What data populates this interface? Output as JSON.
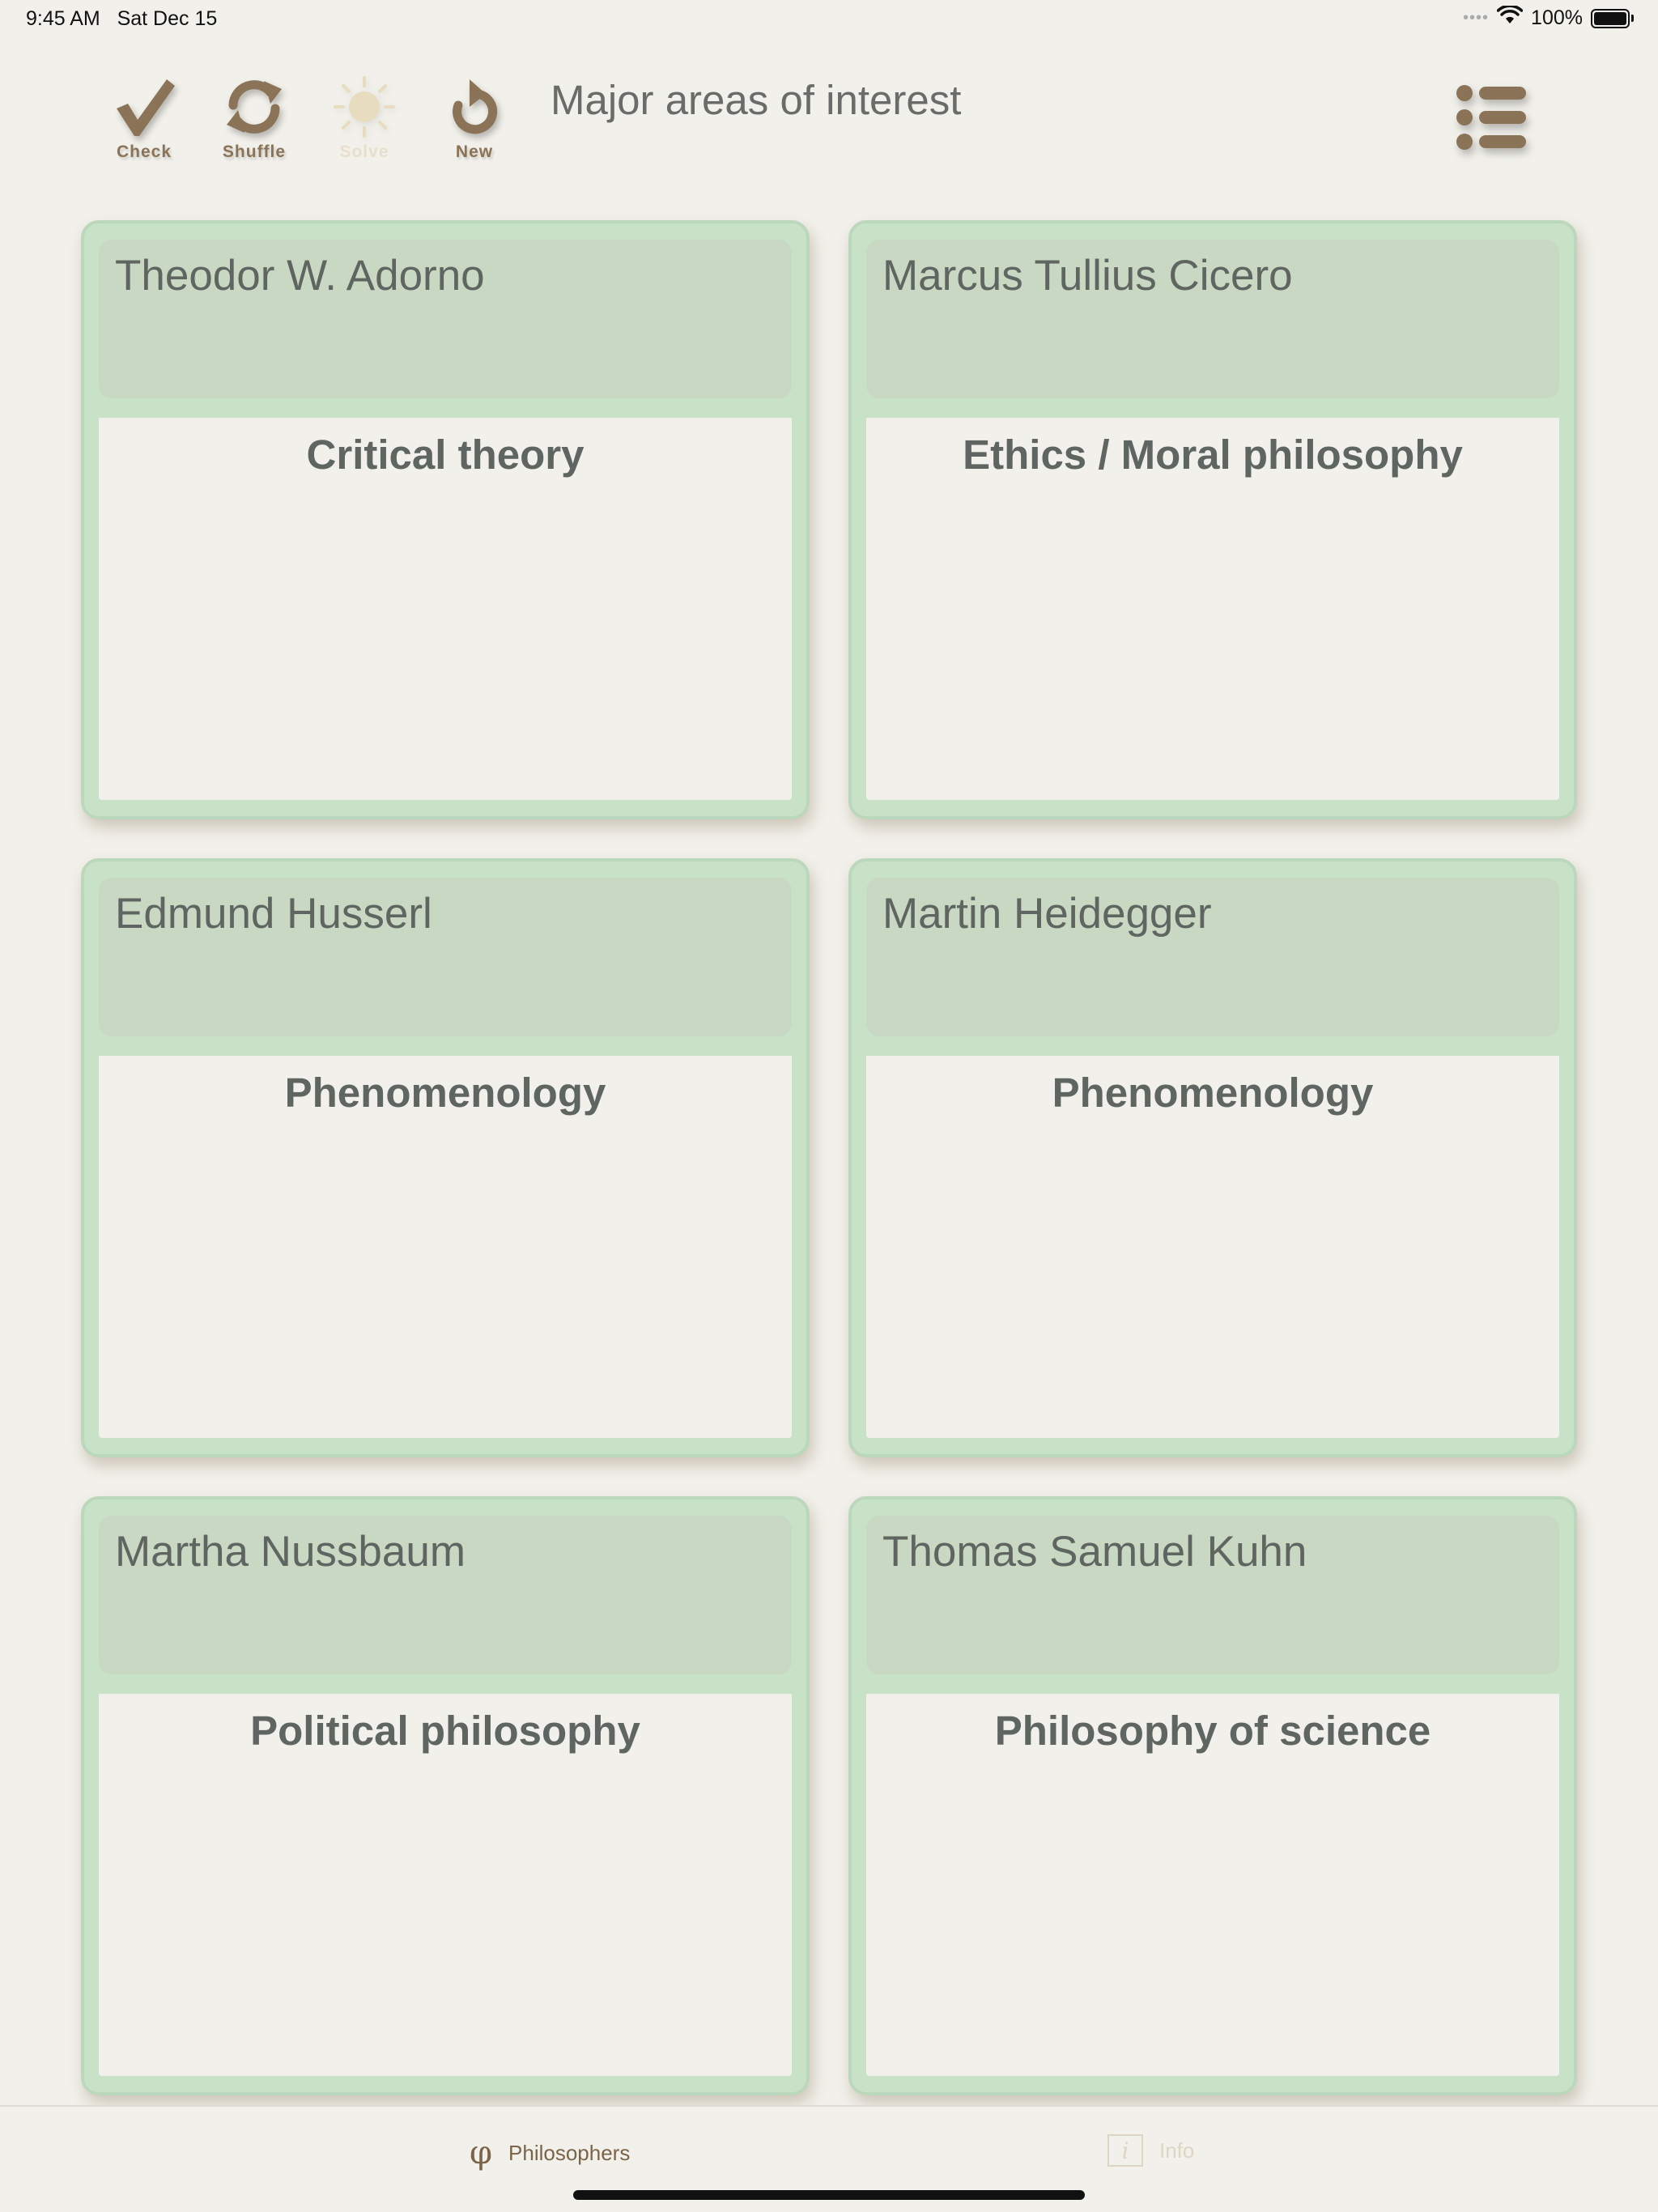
{
  "status_bar": {
    "time": "9:45 AM",
    "date": "Sat Dec 15",
    "battery_percent": "100%",
    "signal_dots": "••••"
  },
  "toolbar": {
    "title": "Major areas of interest",
    "buttons": [
      {
        "label": "Check",
        "icon": "checkmark-icon",
        "enabled": true
      },
      {
        "label": "Shuffle",
        "icon": "shuffle-arrows-icon",
        "enabled": true
      },
      {
        "label": "Solve",
        "icon": "sun-icon",
        "enabled": false
      },
      {
        "label": "New",
        "icon": "refresh-arrow-icon",
        "enabled": true
      }
    ],
    "menu_icon": "list-menu-icon"
  },
  "cards": [
    {
      "philosopher": "Theodor W. Adorno",
      "area": "Critical theory"
    },
    {
      "philosopher": "Marcus Tullius Cicero",
      "area": "Ethics / Moral philosophy"
    },
    {
      "philosopher": "Edmund Husserl",
      "area": "Phenomenology"
    },
    {
      "philosopher": "Martin Heidegger",
      "area": "Phenomenology"
    },
    {
      "philosopher": "Martha Nussbaum",
      "area": "Political philosophy"
    },
    {
      "philosopher": "Thomas Samuel Kuhn",
      "area": "Philosophy of science"
    }
  ],
  "tab_bar": {
    "tabs": [
      {
        "label": "Philosophers",
        "icon": "phi-icon",
        "glyph": "φ",
        "selected": true
      },
      {
        "label": "Info",
        "icon": "info-icon",
        "glyph": "i",
        "selected": false
      }
    ]
  },
  "colors": {
    "background": "#f1f0ea",
    "card_frame": "#c8e2c8",
    "card_header": "#c8d8c2",
    "toolbar_brown": "#8a7356",
    "text_gray": "#5f6560"
  }
}
